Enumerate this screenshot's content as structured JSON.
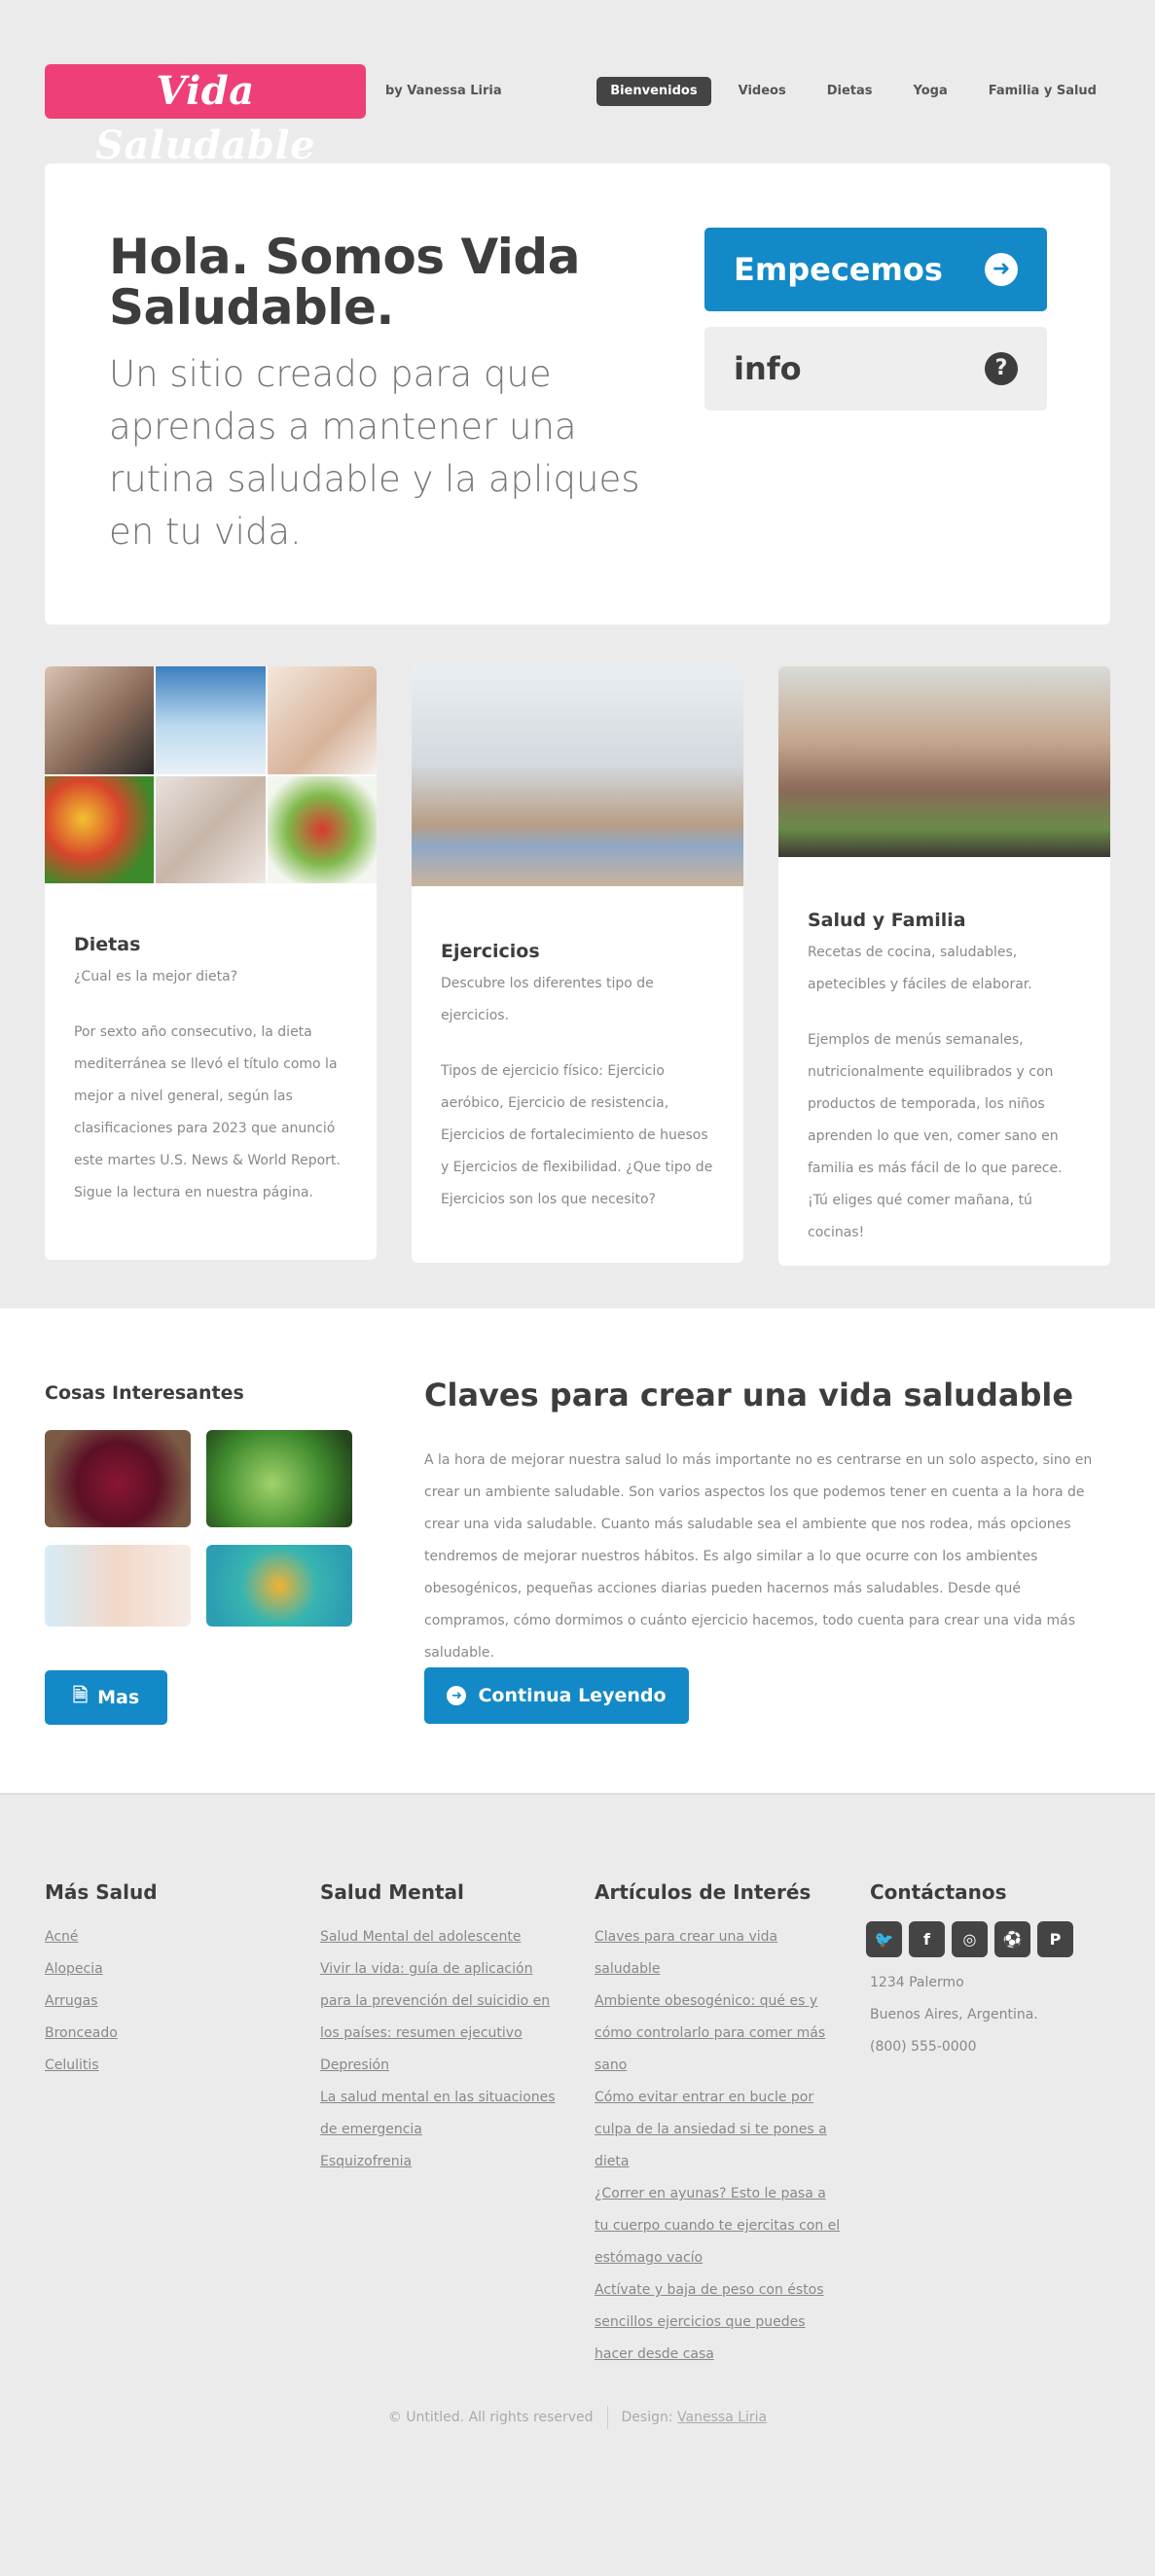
{
  "header": {
    "logo": "Vida Saludable",
    "byline": "by Vanessa Liria",
    "nav": [
      "Bienvenidos",
      "Videos",
      "Dietas",
      "Yoga",
      "Familia y Salud"
    ]
  },
  "hero": {
    "title": "Hola. Somos Vida Saludable.",
    "subtitle": "Un sitio creado para que aprendas a mantener una rutina saludable y la apliques en tu vida.",
    "start_label": "Empecemos",
    "info_label": "info"
  },
  "cards": [
    {
      "title": "Dietas",
      "subtitle": "¿Cual es la mejor dieta?",
      "text": "Por sexto año consecutivo, la dieta mediterránea se llevó el título como la mejor a nivel general, según las clasificaciones para 2023 que anunció este martes U.S. News & World Report. Sigue la lectura en nuestra página."
    },
    {
      "title": "Ejercicios",
      "subtitle": "Descubre los diferentes tipo de ejercicios.",
      "text": "Tipos de ejercicio físico: Ejercicio aeróbico, Ejercicio de resistencia, Ejercicios de fortalecimiento de huesos y Ejercicios de flexibilidad. ¿Que tipo de Ejercicios son los que necesito?"
    },
    {
      "title": "Salud y Familia",
      "subtitle": "Recetas de cocina, saludables, apetecibles y fáciles de elaborar.",
      "text": "Ejemplos de menús semanales, nutricionalmente equilibrados y con productos de temporada, los niños aprenden lo que ven, comer sano en familia es más fácil de lo que parece. ¡Tú eliges qué comer mañana, tú cocinas!"
    }
  ],
  "middle": {
    "side_title": "Cosas Interesantes",
    "mas_label": "Mas",
    "title": "Claves para crear una vida saludable",
    "text": "A la hora de mejorar nuestra salud lo más importante no es centrarse en un solo aspecto, sino en crear un ambiente saludable. Son varios aspectos los que podemos tener en cuenta a la hora de crear una vida saludable. Cuanto más saludable sea el ambiente que nos rodea, más opciones tendremos de mejorar nuestros hábitos. Es algo similar a lo que ocurre con los ambientes obesogénicos, pequeñas acciones diarias pueden hacernos más saludables. Desde qué compramos, cómo dormimos o cuánto ejercicio hacemos, todo cuenta para crear una vida más saludable.",
    "continue_label": "Continua Leyendo"
  },
  "footer": {
    "col1": {
      "title": "Más Salud",
      "links": [
        "Acné",
        "Alopecia",
        "Arrugas",
        "Bronceado",
        "Celulitis"
      ]
    },
    "col2": {
      "title": "Salud Mental",
      "links": [
        "Salud Mental del adolescente",
        "Vivir la vida: guía de aplicación para la prevención del suicidio en los países: resumen ejecutivo",
        "Depresión",
        "La salud mental en las situaciones de emergencia",
        "Esquizofrenia"
      ]
    },
    "col3": {
      "title": "Artículos de Interés",
      "links": [
        "Claves para crear una vida saludable",
        "Ambiente obesogénico: qué es y cómo controlarlo para comer más sano",
        "Cómo evitar entrar en bucle por culpa de la ansiedad si te pones a dieta",
        "¿Correr en ayunas? Esto le pasa a tu cuerpo cuando te ejercitas con el estómago vacío",
        "Actívate y baja de peso con éstos sencillos ejercicios que puedes hacer desde casa"
      ]
    },
    "col4": {
      "title": "Contáctanos",
      "socials": [
        "twitter-icon",
        "facebook-icon",
        "instagram-icon",
        "dribbble-icon",
        "pinterest-icon"
      ],
      "address1": "1234 Palermo",
      "address2": "Buenos Aires, Argentina.",
      "phone": "(800) 555-0000"
    },
    "copyright": "© Untitled. All rights reserved",
    "design_label": "Design:",
    "designer": "Vanessa Liria"
  }
}
